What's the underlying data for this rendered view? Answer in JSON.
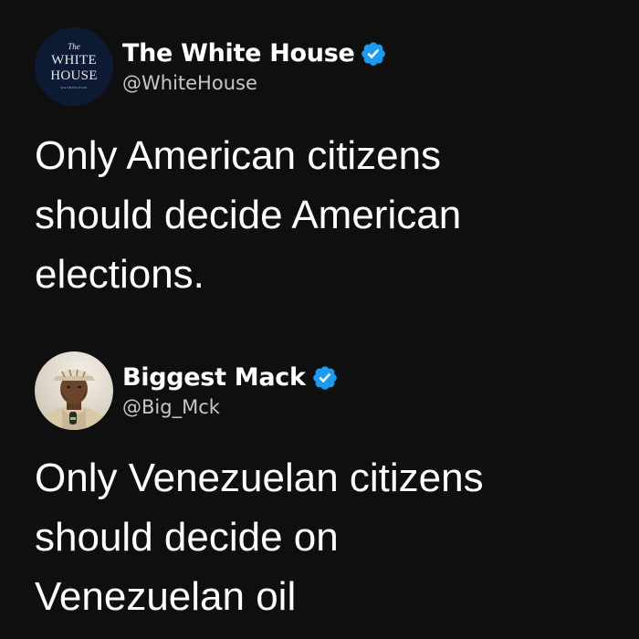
{
  "tweets": [
    {
      "author": {
        "display_name": "The White House",
        "handle": "@WhiteHouse",
        "verified": true,
        "avatar_text": [
          "The",
          "WHITE",
          "HOUSE",
          "WASHINGTON"
        ]
      },
      "text": "Only American citizens\nshould decide American\nelections."
    },
    {
      "author": {
        "display_name": "Biggest Mack",
        "handle": "@Big_Mck",
        "verified": true
      },
      "text": "Only Venezuelan citizens\nshould decide on\nVenezuelan oil"
    }
  ],
  "colors": {
    "background": "#0f0f0f",
    "text": "#ffffff",
    "handle": "#c4c7cc",
    "verified_badge": "#1d9bf0"
  },
  "icons": {
    "verified": "verified-badge-icon"
  }
}
